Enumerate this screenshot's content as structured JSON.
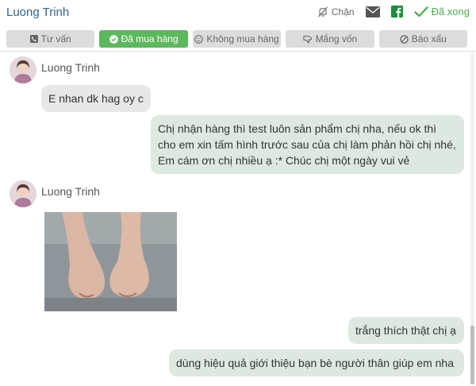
{
  "header": {
    "title": "Luong Trinh",
    "block_label": "Chặn",
    "done_label": "Đã xong"
  },
  "tabs": [
    {
      "label": "Tư vấn",
      "icon": "phone-icon"
    },
    {
      "label": "Đã mua hàng",
      "icon": "check-circle-icon",
      "active": true
    },
    {
      "label": "Không mua hàng",
      "icon": "frown-icon"
    },
    {
      "label": "Mắng vốn",
      "icon": "thumbs-down-icon"
    },
    {
      "label": "Báo xấu",
      "icon": "ban-icon"
    }
  ],
  "messages": [
    {
      "sender": "Luong Trinh",
      "text": "E nhan dk hag oy c"
    },
    {
      "text": "Chị nhận hàng thì test luôn sản phẩm chị nha, nếu ok thì cho em xin tấm hình trước sau của chị làm phản hồi chị nhé, Em cám ơn chị nhiều ạ :* Chúc chị một ngày vui vẻ"
    },
    {
      "sender": "Luong Trinh",
      "attachment": "photo"
    },
    {
      "text": "trắng thích thật chị ạ"
    },
    {
      "text": "dùng hiệu quả giới thiệu bạn bè người thân giúp em nha"
    }
  ],
  "colors": {
    "accent": "#2a6496",
    "active_tab": "#5cb85c",
    "done": "#4caf50",
    "facebook": "#1b8f3a",
    "incoming_bubble": "#e7e7e7",
    "outgoing_bubble": "#dde9e0"
  }
}
